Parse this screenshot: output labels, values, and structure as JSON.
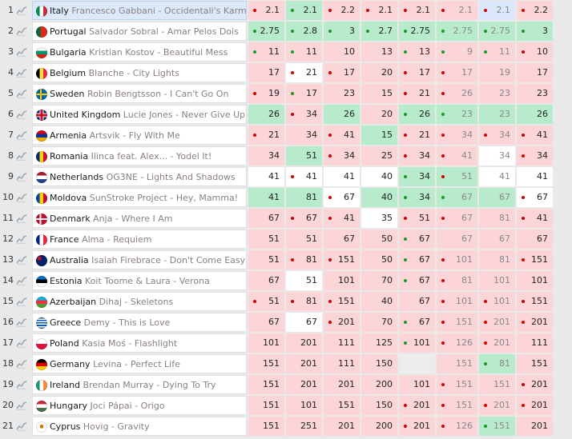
{
  "columns_count": 8,
  "rows": [
    {
      "rank": "1",
      "flag": "it",
      "country": "Italy",
      "song": "Francesco Gabbani - Occidentali's Karma",
      "selected": true,
      "odds": [
        {
          "v": "2.1",
          "c": "pink",
          "d": "red"
        },
        {
          "v": "2.1",
          "c": "green",
          "d": "green"
        },
        {
          "v": "2.2",
          "c": "pink",
          "d": "red"
        },
        {
          "v": "2.1",
          "c": "pink",
          "d": "red"
        },
        {
          "v": "2.1",
          "c": "pink",
          "d": "red"
        },
        {
          "v": "2.1",
          "c": "pink",
          "d": "red",
          "f": true
        },
        {
          "v": "2.1",
          "c": "blue",
          "d": "red",
          "f": true
        },
        {
          "v": "2.2",
          "c": "pink",
          "d": "red"
        }
      ]
    },
    {
      "rank": "2",
      "flag": "pt",
      "country": "Portugal",
      "song": "Salvador Sobral - Amar Pelos Dois",
      "odds": [
        {
          "v": "2.75",
          "c": "green",
          "d": "green"
        },
        {
          "v": "2.8",
          "c": "green",
          "d": "green"
        },
        {
          "v": "3",
          "c": "green",
          "d": "green"
        },
        {
          "v": "2.7",
          "c": "green",
          "d": "green"
        },
        {
          "v": "2.75",
          "c": "green",
          "d": "green"
        },
        {
          "v": "2.75",
          "c": "green",
          "d": "green",
          "f": true
        },
        {
          "v": "2.75",
          "c": "green",
          "d": "green",
          "f": true
        },
        {
          "v": "3",
          "c": "green",
          "d": "green"
        }
      ]
    },
    {
      "rank": "3",
      "flag": "bg",
      "country": "Bulgaria",
      "song": "Kristian Kostov - Beautiful Mess",
      "odds": [
        {
          "v": "11",
          "c": "pink",
          "d": "green"
        },
        {
          "v": "11",
          "c": "pink",
          "d": "green"
        },
        {
          "v": "10",
          "c": "pink"
        },
        {
          "v": "13",
          "c": "pink"
        },
        {
          "v": "13",
          "c": "pink",
          "d": "green"
        },
        {
          "v": "9",
          "c": "pink",
          "d": "green",
          "f": true
        },
        {
          "v": "11",
          "c": "pink",
          "d": "green",
          "f": true
        },
        {
          "v": "10",
          "c": "pink",
          "d": "red"
        }
      ]
    },
    {
      "rank": "4",
      "flag": "be",
      "country": "Belgium",
      "song": "Blanche - City Lights",
      "odds": [
        {
          "v": "17",
          "c": "pink"
        },
        {
          "v": "21",
          "c": "white",
          "d": "red"
        },
        {
          "v": "17",
          "c": "pink",
          "d": "red"
        },
        {
          "v": "20",
          "c": "pink"
        },
        {
          "v": "17",
          "c": "pink",
          "d": "red"
        },
        {
          "v": "17",
          "c": "pink",
          "d": "red",
          "f": true
        },
        {
          "v": "19",
          "c": "pink",
          "f": true
        },
        {
          "v": "17",
          "c": "pink"
        }
      ]
    },
    {
      "rank": "5",
      "flag": "se",
      "country": "Sweden",
      "song": "Robin Bengtsson - I Can't Go On",
      "odds": [
        {
          "v": "19",
          "c": "pink",
          "d": "red"
        },
        {
          "v": "17",
          "c": "pink",
          "d": "green"
        },
        {
          "v": "23",
          "c": "pink"
        },
        {
          "v": "15",
          "c": "pink"
        },
        {
          "v": "21",
          "c": "pink",
          "d": "red"
        },
        {
          "v": "26",
          "c": "pink",
          "d": "red",
          "f": true
        },
        {
          "v": "23",
          "c": "pink",
          "f": true
        },
        {
          "v": "23",
          "c": "pink"
        }
      ]
    },
    {
      "rank": "6",
      "flag": "gb",
      "country": "United Kingdom",
      "song": "Lucie Jones - Never Give Up on You",
      "odds": [
        {
          "v": "26",
          "c": "green"
        },
        {
          "v": "34",
          "c": "pink",
          "d": "red"
        },
        {
          "v": "26",
          "c": "green"
        },
        {
          "v": "20",
          "c": "pink"
        },
        {
          "v": "26",
          "c": "green",
          "d": "green"
        },
        {
          "v": "23",
          "c": "green",
          "d": "green",
          "f": true
        },
        {
          "v": "23",
          "c": "green",
          "f": true
        },
        {
          "v": "26",
          "c": "green"
        }
      ]
    },
    {
      "rank": "7",
      "flag": "am",
      "country": "Armenia",
      "song": "Artsvik - Fly With Me",
      "odds": [
        {
          "v": "21",
          "c": "pink",
          "d": "red"
        },
        {
          "v": "34",
          "c": "pink"
        },
        {
          "v": "41",
          "c": "pink",
          "d": "red"
        },
        {
          "v": "15",
          "c": "green"
        },
        {
          "v": "21",
          "c": "pink",
          "d": "red"
        },
        {
          "v": "34",
          "c": "pink",
          "d": "red",
          "f": true
        },
        {
          "v": "34",
          "c": "pink",
          "d": "red",
          "f": true
        },
        {
          "v": "41",
          "c": "pink",
          "d": "red"
        }
      ]
    },
    {
      "rank": "8",
      "flag": "ro",
      "country": "Romania",
      "song": "Ilinca feat. Alex... - Yodel It!",
      "odds": [
        {
          "v": "34",
          "c": "pink"
        },
        {
          "v": "51",
          "c": "green"
        },
        {
          "v": "34",
          "c": "pink",
          "d": "red"
        },
        {
          "v": "25",
          "c": "pink"
        },
        {
          "v": "34",
          "c": "pink",
          "d": "red"
        },
        {
          "v": "41",
          "c": "pink",
          "d": "red",
          "f": true
        },
        {
          "v": "34",
          "c": "white",
          "f": true
        },
        {
          "v": "34",
          "c": "pink",
          "d": "red"
        }
      ]
    },
    {
      "rank": "9",
      "flag": "nl",
      "country": "Netherlands",
      "song": "OG3NE - Lights And Shadows",
      "odds": [
        {
          "v": "41",
          "c": "white"
        },
        {
          "v": "41",
          "c": "white",
          "d": "red"
        },
        {
          "v": "41",
          "c": "white"
        },
        {
          "v": "40",
          "c": "white"
        },
        {
          "v": "34",
          "c": "green",
          "d": "green"
        },
        {
          "v": "51",
          "c": "green",
          "d": "red",
          "f": true
        },
        {
          "v": "41",
          "c": "white",
          "f": true
        },
        {
          "v": "41",
          "c": "white"
        }
      ]
    },
    {
      "rank": "10",
      "flag": "md",
      "country": "Moldova",
      "song": "SunStroke Project - Hey, Mamma!",
      "odds": [
        {
          "v": "41",
          "c": "green"
        },
        {
          "v": "81",
          "c": "green"
        },
        {
          "v": "67",
          "c": "white",
          "d": "red"
        },
        {
          "v": "40",
          "c": "green"
        },
        {
          "v": "34",
          "c": "green",
          "d": "green"
        },
        {
          "v": "67",
          "c": "green",
          "d": "green",
          "f": true
        },
        {
          "v": "67",
          "c": "green",
          "f": true
        },
        {
          "v": "67",
          "c": "white",
          "d": "red"
        }
      ]
    },
    {
      "rank": "11",
      "flag": "dk",
      "country": "Denmark",
      "song": "Anja - Where I Am",
      "odds": [
        {
          "v": "67",
          "c": "pink"
        },
        {
          "v": "67",
          "c": "pink",
          "d": "red"
        },
        {
          "v": "41",
          "c": "pink",
          "d": "red"
        },
        {
          "v": "35",
          "c": "white"
        },
        {
          "v": "51",
          "c": "pink",
          "d": "red"
        },
        {
          "v": "67",
          "c": "pink",
          "d": "red",
          "f": true
        },
        {
          "v": "81",
          "c": "pink",
          "f": true
        },
        {
          "v": "41",
          "c": "pink",
          "d": "red"
        }
      ]
    },
    {
      "rank": "12",
      "flag": "fr",
      "country": "France",
      "song": "Alma - Requiem",
      "odds": [
        {
          "v": "51",
          "c": "pink"
        },
        {
          "v": "51",
          "c": "pink"
        },
        {
          "v": "67",
          "c": "pink"
        },
        {
          "v": "50",
          "c": "pink"
        },
        {
          "v": "67",
          "c": "pink",
          "d": "green"
        },
        {
          "v": "67",
          "c": "pink",
          "f": true
        },
        {
          "v": "67",
          "c": "pink",
          "f": true
        },
        {
          "v": "67",
          "c": "pink"
        }
      ]
    },
    {
      "rank": "13",
      "flag": "au",
      "country": "Australia",
      "song": "Isaiah Firebrace - Don't Come Easy",
      "odds": [
        {
          "v": "51",
          "c": "pink"
        },
        {
          "v": "81",
          "c": "pink",
          "d": "red"
        },
        {
          "v": "151",
          "c": "pink",
          "d": "red"
        },
        {
          "v": "50",
          "c": "pink"
        },
        {
          "v": "67",
          "c": "pink",
          "d": "green"
        },
        {
          "v": "101",
          "c": "pink",
          "d": "red",
          "f": true
        },
        {
          "v": "81",
          "c": "pink",
          "f": true
        },
        {
          "v": "151",
          "c": "pink",
          "d": "red"
        }
      ]
    },
    {
      "rank": "14",
      "flag": "ee",
      "country": "Estonia",
      "song": "Koit Toome & Laura - Verona",
      "odds": [
        {
          "v": "67",
          "c": "pink"
        },
        {
          "v": "51",
          "c": "white"
        },
        {
          "v": "101",
          "c": "pink"
        },
        {
          "v": "70",
          "c": "pink"
        },
        {
          "v": "67",
          "c": "pink",
          "d": "green"
        },
        {
          "v": "81",
          "c": "pink",
          "d": "red",
          "f": true
        },
        {
          "v": "101",
          "c": "pink",
          "f": true
        },
        {
          "v": "101",
          "c": "pink"
        }
      ]
    },
    {
      "rank": "15",
      "flag": "az",
      "country": "Azerbaijan",
      "song": "Dihaj - Skeletons",
      "odds": [
        {
          "v": "51",
          "c": "pink",
          "d": "red"
        },
        {
          "v": "81",
          "c": "pink",
          "d": "red"
        },
        {
          "v": "151",
          "c": "pink",
          "d": "red"
        },
        {
          "v": "40",
          "c": "pink"
        },
        {
          "v": "67",
          "c": "pink"
        },
        {
          "v": "101",
          "c": "pink",
          "d": "red",
          "f": true
        },
        {
          "v": "101",
          "c": "pink",
          "d": "red",
          "f": true
        },
        {
          "v": "151",
          "c": "pink",
          "d": "red"
        }
      ]
    },
    {
      "rank": "16",
      "flag": "gr",
      "country": "Greece",
      "song": "Demy - This is Love",
      "odds": [
        {
          "v": "67",
          "c": "pink"
        },
        {
          "v": "67",
          "c": "white"
        },
        {
          "v": "201",
          "c": "pink",
          "d": "red"
        },
        {
          "v": "70",
          "c": "pink"
        },
        {
          "v": "67",
          "c": "pink",
          "d": "green"
        },
        {
          "v": "151",
          "c": "pink",
          "d": "red",
          "f": true
        },
        {
          "v": "201",
          "c": "pink",
          "d": "red",
          "f": true
        },
        {
          "v": "201",
          "c": "pink",
          "d": "red"
        }
      ]
    },
    {
      "rank": "17",
      "flag": "pl",
      "country": "Poland",
      "song": "Kasia Moś - Flashlight",
      "odds": [
        {
          "v": "101",
          "c": "pink"
        },
        {
          "v": "201",
          "c": "pink"
        },
        {
          "v": "111",
          "c": "pink"
        },
        {
          "v": "125",
          "c": "pink"
        },
        {
          "v": "101",
          "c": "pink",
          "d": "green"
        },
        {
          "v": "126",
          "c": "pink",
          "d": "red",
          "f": true
        },
        {
          "v": "201",
          "c": "pink",
          "d": "red",
          "f": true
        },
        {
          "v": "111",
          "c": "pink"
        }
      ]
    },
    {
      "rank": "18",
      "flag": "de",
      "country": "Germany",
      "song": "Levina - Perfect Life",
      "odds": [
        {
          "v": "151",
          "c": "pink"
        },
        {
          "v": "201",
          "c": "pink"
        },
        {
          "v": "111",
          "c": "pink"
        },
        {
          "v": "150",
          "c": "pink"
        },
        {
          "v": "",
          "c": "grey"
        },
        {
          "v": "151",
          "c": "pink",
          "f": true
        },
        {
          "v": "81",
          "c": "green",
          "d": "green",
          "f": true
        },
        {
          "v": "151",
          "c": "pink"
        }
      ]
    },
    {
      "rank": "19",
      "flag": "ie",
      "country": "Ireland",
      "song": "Brendan Murray - Dying To Try",
      "odds": [
        {
          "v": "151",
          "c": "pink"
        },
        {
          "v": "201",
          "c": "pink"
        },
        {
          "v": "201",
          "c": "pink"
        },
        {
          "v": "200",
          "c": "pink"
        },
        {
          "v": "101",
          "c": "pink"
        },
        {
          "v": "151",
          "c": "pink",
          "d": "red",
          "f": true
        },
        {
          "v": "151",
          "c": "pink",
          "f": true
        },
        {
          "v": "201",
          "c": "pink",
          "d": "red"
        }
      ]
    },
    {
      "rank": "20",
      "flag": "hu",
      "country": "Hungary",
      "song": "Joci Pápai - Origo",
      "odds": [
        {
          "v": "151",
          "c": "pink"
        },
        {
          "v": "101",
          "c": "pink"
        },
        {
          "v": "151",
          "c": "pink"
        },
        {
          "v": "150",
          "c": "pink"
        },
        {
          "v": "201",
          "c": "pink",
          "d": "red"
        },
        {
          "v": "151",
          "c": "pink",
          "d": "red",
          "f": true
        },
        {
          "v": "201",
          "c": "pink",
          "d": "red",
          "f": true
        },
        {
          "v": "201",
          "c": "pink",
          "d": "red"
        }
      ]
    },
    {
      "rank": "21",
      "flag": "cy",
      "country": "Cyprus",
      "song": "Hovig - Gravity",
      "odds": [
        {
          "v": "151",
          "c": "pink"
        },
        {
          "v": "251",
          "c": "pink"
        },
        {
          "v": "201",
          "c": "pink"
        },
        {
          "v": "200",
          "c": "pink"
        },
        {
          "v": "201",
          "c": "pink",
          "d": "red"
        },
        {
          "v": "126",
          "c": "pink",
          "d": "red",
          "f": true
        },
        {
          "v": "151",
          "c": "green",
          "d": "green",
          "f": true
        },
        {
          "v": "201",
          "c": "pink"
        }
      ]
    }
  ]
}
